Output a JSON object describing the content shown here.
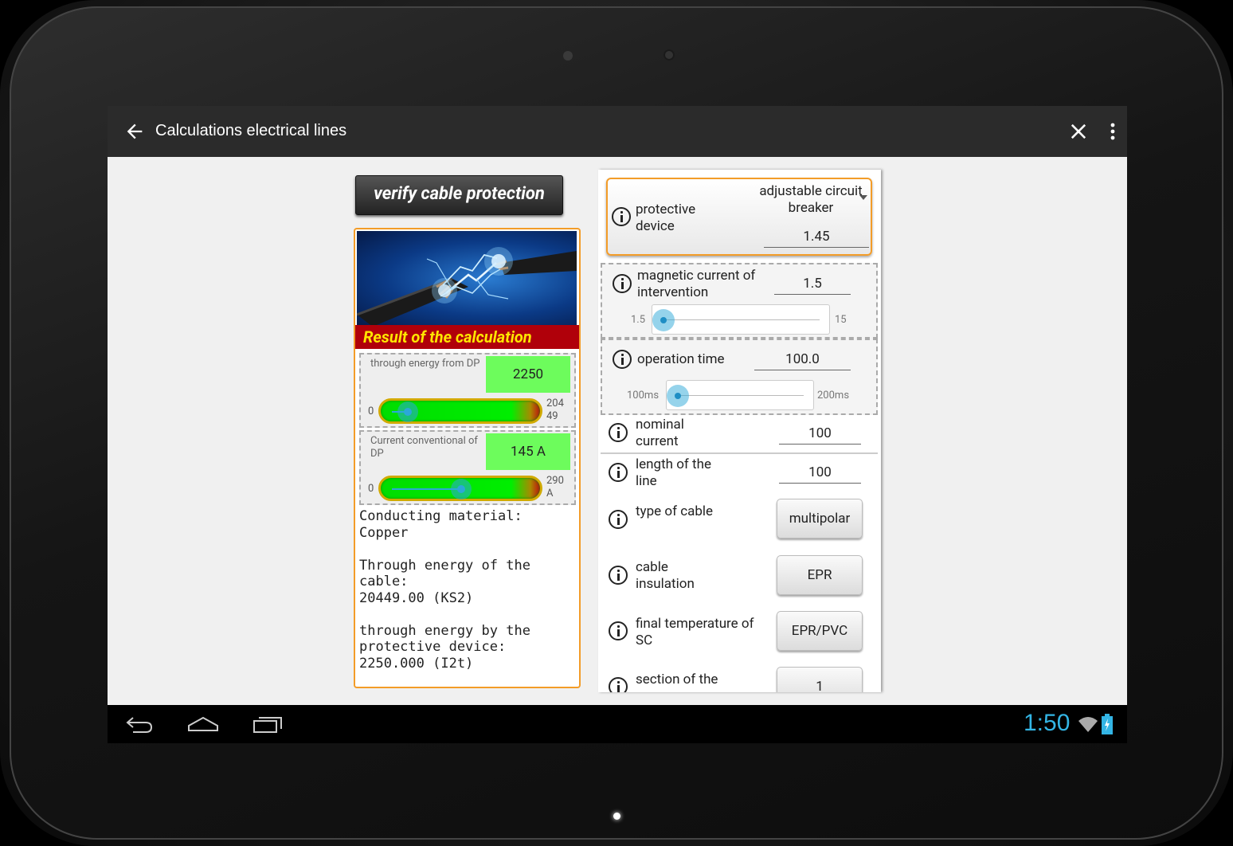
{
  "app": {
    "title": "Calculations electrical lines"
  },
  "left": {
    "verify_button": "verify cable protection",
    "result_banner": "Result of the calculation",
    "meter1": {
      "label": "through energy from DP",
      "value": "2250",
      "min": "0",
      "max": "204 49",
      "fill_fraction": 0.11
    },
    "meter2": {
      "label": "Current conventional of DP",
      "value": "145 A",
      "min": "0",
      "max": "290 A",
      "fill_fraction": 0.5
    },
    "summary_text": "Conducting material:\nCopper\n\nThrough energy of the\ncable:\n20449.00 (KS2)\n\nthrough energy by the\nprotective device:\n2250.000 (I2t)"
  },
  "right": {
    "protective_device": {
      "label": "protective device",
      "selected": "adjustable circuit breaker",
      "value": "1.45"
    },
    "magnetic_current": {
      "label": "magnetic current of intervention",
      "value": "1.5",
      "min": "1.5",
      "max": "15"
    },
    "operation_time": {
      "label": "operation time",
      "value": "100.0",
      "min": "100ms",
      "max": "200ms"
    },
    "nominal_current": {
      "label": "nominal current",
      "value": "100"
    },
    "length_line": {
      "label": "length of the line",
      "value": "100"
    },
    "type_cable": {
      "label": "type of cable",
      "value": "multipolar"
    },
    "cable_insulation": {
      "label": "cable insulation",
      "value": "EPR"
    },
    "final_temperature": {
      "label": "final temperature of SC",
      "value": "EPR/PVC"
    },
    "section": {
      "label": "section of the",
      "value": "1"
    }
  },
  "statusbar": {
    "time": "1:50"
  },
  "colors": {
    "accent_orange": "#f39c28",
    "banner_red": "#b0000a",
    "banner_yellow": "#ffe600",
    "meter_green": "#6dfc5c",
    "holo_blue": "#33b5e5"
  }
}
